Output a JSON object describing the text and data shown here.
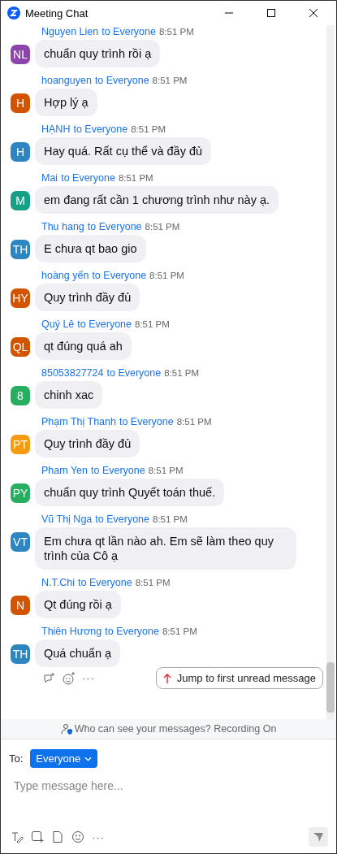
{
  "window": {
    "title": "Meeting Chat"
  },
  "messages": [
    {
      "avatar": "NL",
      "color": "#8e44ad",
      "sender": "Nguyen Lien",
      "recipient": "to Everyone",
      "time": "8:51 PM",
      "text": "chuẩn quy trình rồi ạ"
    },
    {
      "avatar": "H",
      "color": "#d35400",
      "sender": "hoanguyen",
      "recipient": "to Everyone",
      "time": "8:51 PM",
      "text": "Hợp lý ạ"
    },
    {
      "avatar": "H",
      "color": "#2e86c1",
      "sender": "HẠNH",
      "recipient": "to Everyone",
      "time": "8:51 PM",
      "text": "Hay quá. Rất cụ thể và đầy đủ"
    },
    {
      "avatar": "M",
      "color": "#16a085",
      "sender": "Mai",
      "recipient": "to Everyone",
      "time": "8:51 PM",
      "text": "em đang rất cần 1 chương trình như này ạ."
    },
    {
      "avatar": "TH",
      "color": "#2e86c1",
      "sender": "Thu hang",
      "recipient": "to Everyone",
      "time": "8:51 PM",
      "text": "E chưa qt bao gio"
    },
    {
      "avatar": "HY",
      "color": "#d35400",
      "sender": "hoàng yến",
      "recipient": "to Everyone",
      "time": "8:51 PM",
      "text": "Quy trình đầy đủ"
    },
    {
      "avatar": "QL",
      "color": "#d35400",
      "sender": "Quý Lê",
      "recipient": "to Everyone",
      "time": "8:51 PM",
      "text": "qt đúng quá ah"
    },
    {
      "avatar": "8",
      "color": "#27ae60",
      "sender": "85053827724",
      "recipient": "to Everyone",
      "time": "8:51 PM",
      "text": "chinh xac"
    },
    {
      "avatar": "PT",
      "color": "#f39c12",
      "sender": "Phạm Thị Thanh",
      "recipient": "to Everyone",
      "time": "8:51 PM",
      "text": "Quy trình đầy đủ"
    },
    {
      "avatar": "PY",
      "color": "#27ae60",
      "sender": "Pham Yen",
      "recipient": "to Everyone",
      "time": "8:51 PM",
      "text": "chuẩn quy trình Quyết toán thuế."
    },
    {
      "avatar": "VT",
      "color": "#2e86c1",
      "sender": "Vũ Thị Nga",
      "recipient": "to Everyone",
      "time": "8:51 PM",
      "text": "Em chưa qt lần nào ah. Em sẽ làm theo quy trình của Cô ạ"
    },
    {
      "avatar": "N",
      "color": "#d35400",
      "sender": "N.T.Chi",
      "recipient": "to Everyone",
      "time": "8:51 PM",
      "text": "Qt đúng rồi ạ"
    },
    {
      "avatar": "TH",
      "color": "#2e86c1",
      "sender": "Thiên Hương",
      "recipient": "to Everyone",
      "time": "8:51 PM",
      "text": "Quá chuẩn ạ"
    }
  ],
  "reaction_more": "···",
  "jump_button": "Jump to first unread message",
  "privacy_notice": "Who can see your messages? Recording On",
  "to_label": "To:",
  "recipient_button": "Everyone",
  "compose": {
    "placeholder": "Type message here..."
  },
  "toolbar_more": "···"
}
